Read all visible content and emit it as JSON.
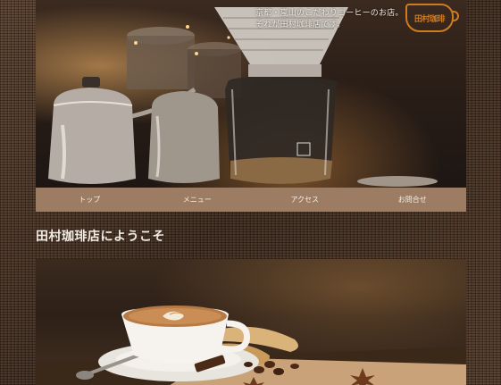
{
  "hero": {
    "caption_line1": "京都・嵐山のこだわりコーヒーのお店。",
    "caption_line2": "それが田村珈琲店です。",
    "logo_text": "田村珈琲"
  },
  "nav": {
    "items": [
      "トップ",
      "メニュー",
      "アクセス",
      "お問合せ"
    ]
  },
  "welcome": {
    "title": "田村珈琲店にようこそ"
  },
  "icons": {
    "logo": "coffee-cup-logo"
  },
  "colors": {
    "nav_bg": "#9c7d63",
    "logo": "#d07a22",
    "background": "#4a3426"
  }
}
